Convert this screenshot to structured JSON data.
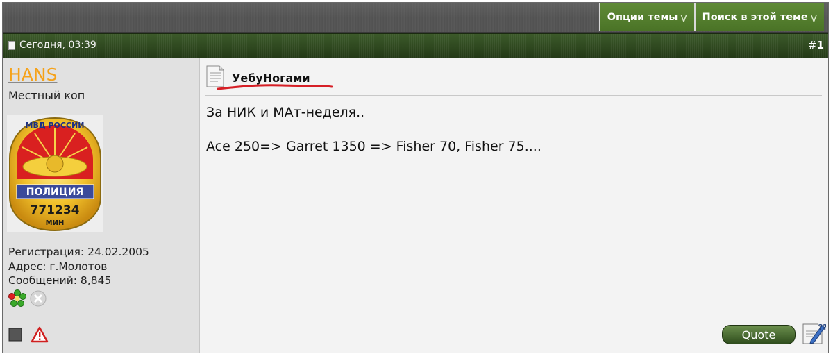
{
  "toolbar": {
    "thread_options": "Опции темы",
    "search_thread": "Поиск в этой теме"
  },
  "post_header": {
    "date": "Сегодня, 03:39",
    "number_prefix": "#",
    "number": "1"
  },
  "user": {
    "name": "HANS",
    "title": "Местный коп",
    "registration": "Регистрация: 24.02.2005",
    "address": "Адрес: г.Молотов",
    "messages": "Сообщений: 8,845",
    "avatar": {
      "top_text": "МВД РОССИИ",
      "band_text": "ПОЛИЦИЯ",
      "number": "771234",
      "bottom_text": "МИН"
    }
  },
  "post": {
    "title": "УебуНогами",
    "text": "За НИК и МАт-неделя..",
    "signature": "Ace 250=> Garret 1350 => Fisher 70, Fisher 75...."
  },
  "buttons": {
    "quote": "Quote"
  },
  "colors": {
    "accent_green": "#4a7326",
    "username_orange": "#f5a21a",
    "annotation_red": "#d61f26"
  }
}
